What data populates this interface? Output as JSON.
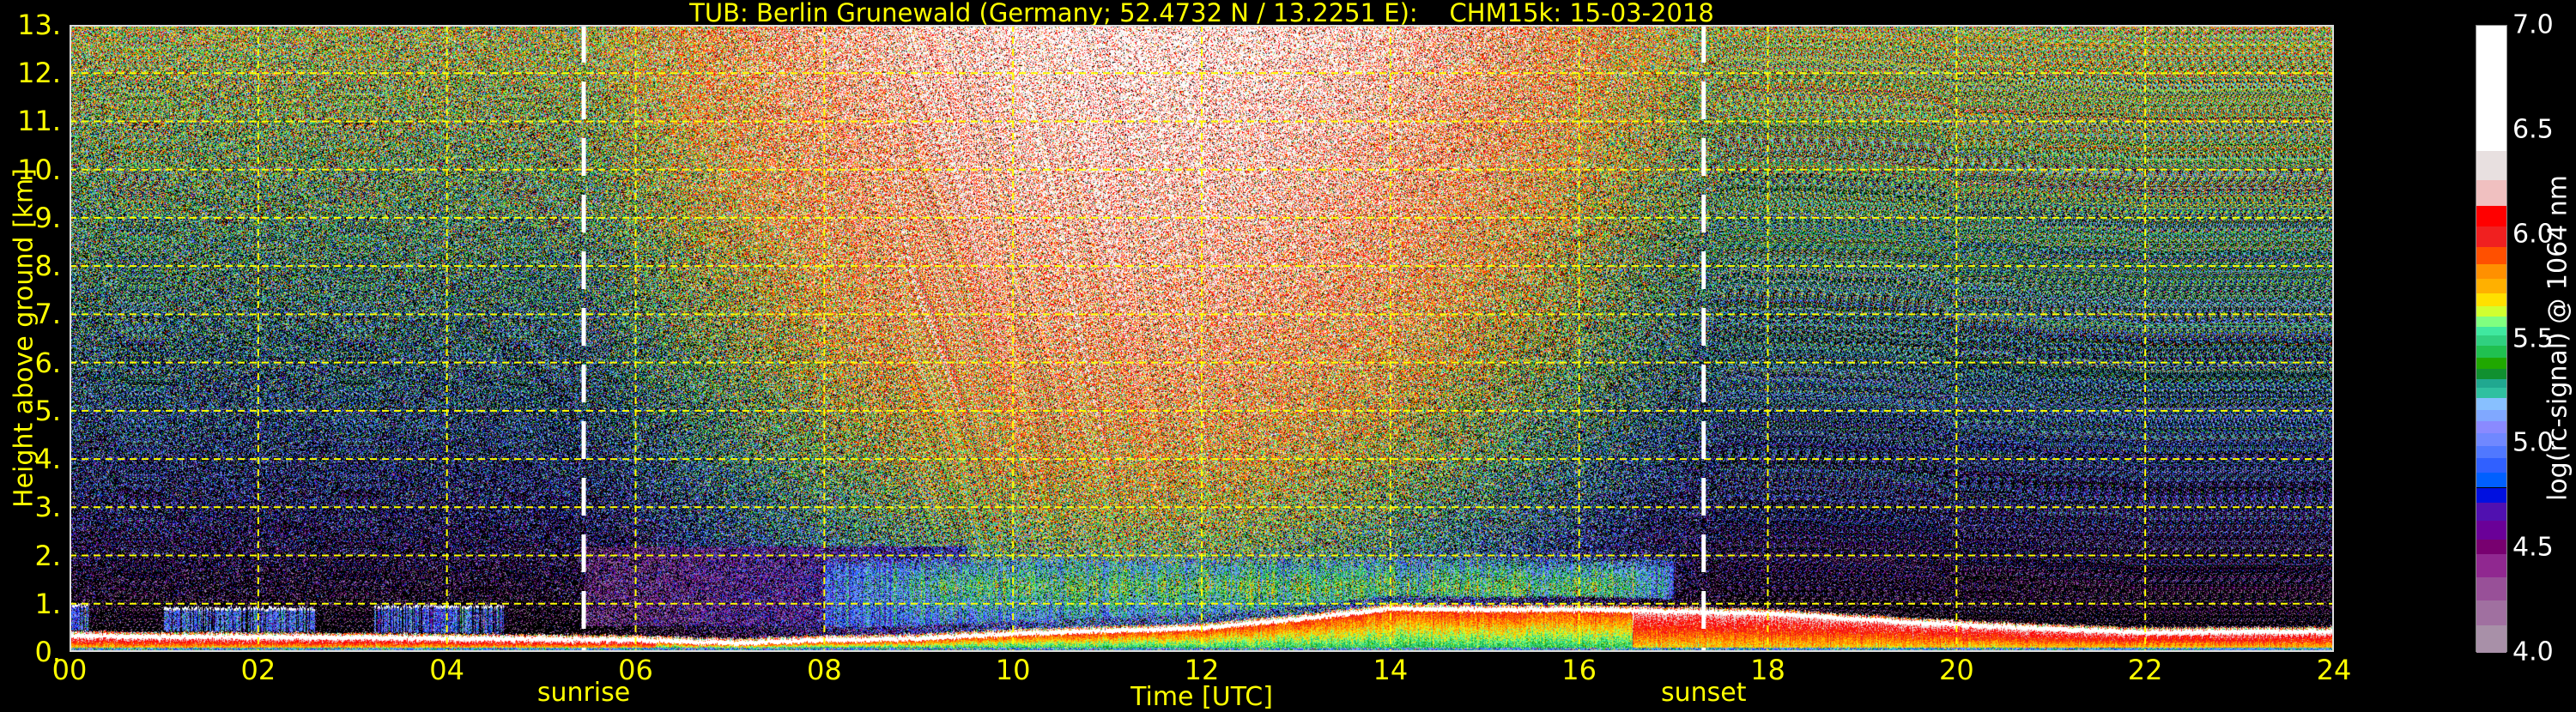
{
  "title": "TUB: Berlin Grunewald (Germany; 52.4732 N / 13.2251 E):    CHM15k: 15-03-2018",
  "chart_data": {
    "type": "heatmap",
    "title": "TUB: Berlin Grunewald (Germany; 52.4732 N / 13.2251 E):    CHM15k: 15-03-2018",
    "xlabel": "Time [UTC]",
    "ylabel": "Height above ground [km]",
    "xlim": [
      0,
      24
    ],
    "ylim": [
      0,
      13
    ],
    "x_ticks": [
      "00",
      "02",
      "04",
      "06",
      "08",
      "10",
      "12",
      "14",
      "16",
      "18",
      "20",
      "22",
      "24"
    ],
    "x_tick_values": [
      0,
      2,
      4,
      6,
      8,
      10,
      12,
      14,
      16,
      18,
      20,
      22,
      24
    ],
    "y_ticks": [
      "0.",
      "1.",
      "2.",
      "3.",
      "4.",
      "5.",
      "6.",
      "7.",
      "8.",
      "9.",
      "10.",
      "11.",
      "12.",
      "13."
    ],
    "y_tick_values": [
      0,
      1,
      2,
      3,
      4,
      5,
      6,
      7,
      8,
      9,
      10,
      11,
      12,
      13
    ],
    "grid": true,
    "grid_color": "#ffff00",
    "events": [
      {
        "label": "sunrise",
        "time": 5.45
      },
      {
        "label": "sunset",
        "time": 17.32
      }
    ],
    "colorbar": {
      "label": "log(rc-signal) @ 1064 nm",
      "range": [
        4.0,
        7.0
      ],
      "ticks": [
        "4.0",
        "4.5",
        "5.0",
        "5.5",
        "6.0",
        "6.5",
        "7.0"
      ],
      "tick_values": [
        4.0,
        4.5,
        5.0,
        5.5,
        6.0,
        6.5,
        7.0
      ],
      "boundaries": [
        4.0,
        4.13,
        4.25,
        4.36,
        4.47,
        4.54,
        4.63,
        4.72,
        4.79,
        4.86,
        4.93,
        4.99,
        5.05,
        5.11,
        5.16,
        5.22,
        5.27,
        5.31,
        5.36,
        5.41,
        5.47,
        5.52,
        5.56,
        5.61,
        5.66,
        5.72,
        5.79,
        5.86,
        5.94,
        6.04,
        6.14,
        6.26,
        6.4,
        6.58,
        7.0
      ],
      "colors": [
        "#a890a8",
        "#a070a0",
        "#985098",
        "#902890",
        "#780070",
        "#6a0098",
        "#5010b0",
        "#0010e0",
        "#0060ff",
        "#3060ff",
        "#5078ff",
        "#7088ff",
        "#8a8aff",
        "#80a8ff",
        "#88c0ff",
        "#30c0a0",
        "#20a890",
        "#109030",
        "#20a800",
        "#20c050",
        "#30d080",
        "#40e8a0",
        "#80ff80",
        "#d0ff30",
        "#ffe000",
        "#ffb000",
        "#ff9000",
        "#ff5000",
        "#f02020",
        "#ff0000",
        "#f0c0c0",
        "#e8e0e0",
        "#ffffff",
        "#ffffff"
      ]
    },
    "boundary_layer_top_km": {
      "time": [
        0,
        1,
        2,
        3,
        4,
        5,
        6,
        7,
        8,
        9,
        10,
        11,
        12,
        13,
        14,
        15,
        16,
        17,
        18,
        19,
        20,
        21,
        22,
        23,
        24
      ],
      "height": [
        0.36,
        0.34,
        0.33,
        0.32,
        0.3,
        0.29,
        0.27,
        0.21,
        0.27,
        0.3,
        0.4,
        0.46,
        0.52,
        0.7,
        0.92,
        0.9,
        0.9,
        0.86,
        0.82,
        0.7,
        0.58,
        0.5,
        0.43,
        0.44,
        0.45
      ]
    },
    "cloud_layers": [
      {
        "start": 0.0,
        "end": 0.2,
        "base_km": 0.95
      },
      {
        "start": 1.0,
        "end": 2.6,
        "base_km": 0.88
      },
      {
        "start": 3.2,
        "end": 4.6,
        "base_km": 0.92
      }
    ],
    "aerosol_layer": {
      "start": 9.0,
      "end": 17.0,
      "top_km": 1.9
    }
  }
}
